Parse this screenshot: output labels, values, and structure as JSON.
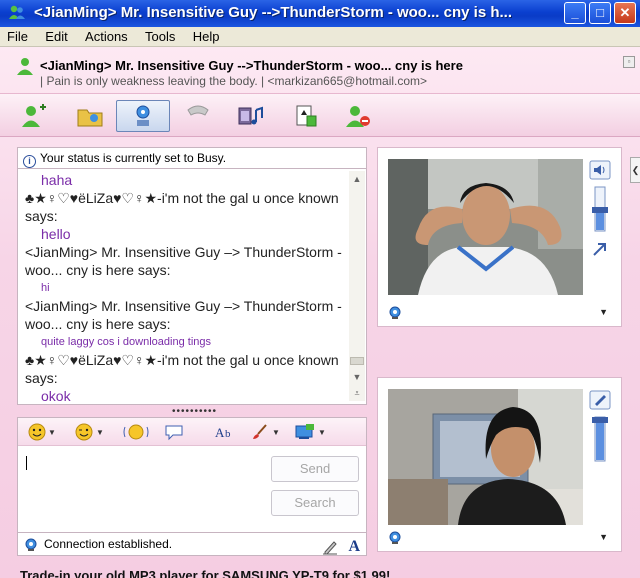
{
  "window": {
    "title": "<JianMing> Mr. Insensitive Guy -->ThunderStorm - woo... cny is h...",
    "controls": {
      "minimize": "_",
      "maximize": "□",
      "close": "✕"
    }
  },
  "menu": [
    "File",
    "Edit",
    "Actions",
    "Tools",
    "Help"
  ],
  "contact": {
    "name": "<JianMing> Mr. Insensitive Guy -->ThunderStorm - woo... cny is here",
    "subline": "| Pain is only weakness leaving the body. | <markizan665@hotmail.com>"
  },
  "status_message": "Your status is currently set to Busy.",
  "conversation": [
    {
      "kind": "body",
      "text": "haha",
      "small": false
    },
    {
      "kind": "head",
      "text": "♣★♀♡♥ëLiZa♥♡♀★-i'm not the gal u once known says:"
    },
    {
      "kind": "body",
      "text": "hello",
      "small": false
    },
    {
      "kind": "head",
      "text": "<JianMing> Mr. Insensitive Guy –> ThunderStorm - woo... cny is here says:"
    },
    {
      "kind": "body",
      "text": "hi",
      "small": true
    },
    {
      "kind": "head",
      "text": "<JianMing> Mr. Insensitive Guy –> ThunderStorm - woo... cny is here says:"
    },
    {
      "kind": "body",
      "text": "quite laggy cos i downloading tings",
      "small": true
    },
    {
      "kind": "head",
      "text": "♣★♀♡♥ëLiZa♥♡♀★-i'm not the gal u once known says:"
    },
    {
      "kind": "body",
      "text": "okok",
      "small": false
    }
  ],
  "splitter": "••••••••••",
  "compose": {
    "send_label": "Send",
    "search_label": "Search",
    "input_value": ""
  },
  "connection_status": "Connection established.",
  "font_button": "A",
  "ad_text": "Trade-in your old MP3 player for SAMSUNG YP-T9 for $1.99!",
  "colors": {
    "titlebar": "#0a3fcf",
    "window_bg": "#f7d5e7",
    "message_text": "#7a2ca8"
  }
}
